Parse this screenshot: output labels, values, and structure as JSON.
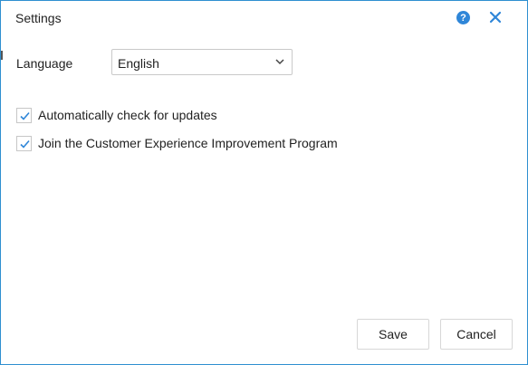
{
  "window": {
    "title": "Settings",
    "help_icon": "help-icon",
    "help_symbol": "?",
    "close_icon": "close-icon"
  },
  "language": {
    "label": "Language",
    "selected": "English",
    "dropdown_icon": "chevron-down-icon"
  },
  "options": [
    {
      "label": "Automatically check for updates",
      "checked": true
    },
    {
      "label": "Join the Customer Experience Improvement Program",
      "checked": true
    }
  ],
  "footer": {
    "save_label": "Save",
    "cancel_label": "Cancel"
  },
  "colors": {
    "accent": "#2f86d8",
    "border": "#2f8fd0"
  }
}
